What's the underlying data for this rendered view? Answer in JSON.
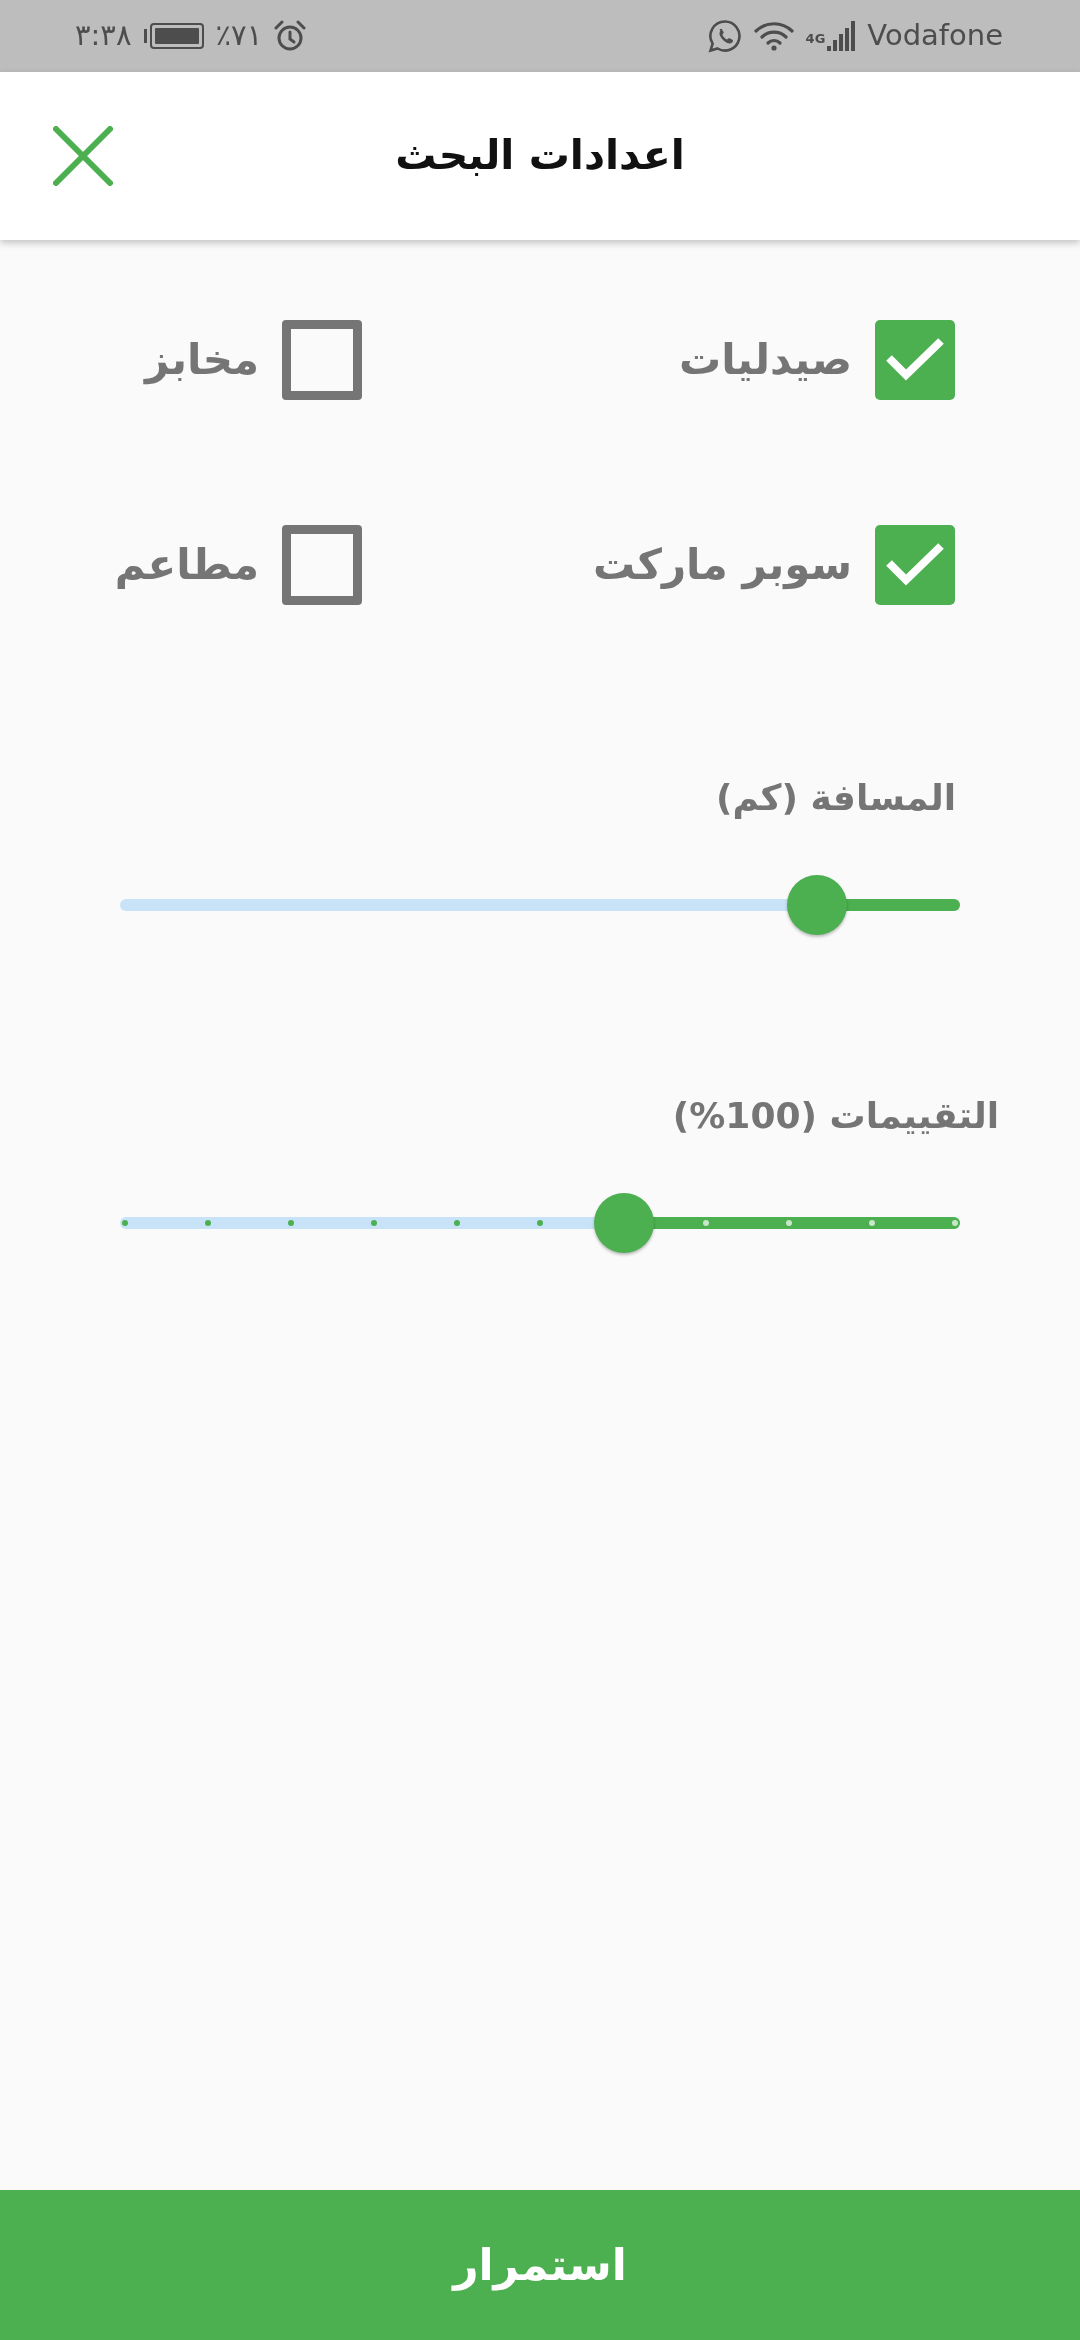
{
  "status_bar": {
    "time": "٣:٣٨",
    "battery": "٪٧١",
    "network": "4G",
    "carrier": "Vodafone"
  },
  "header": {
    "title": "اعدادات البحث"
  },
  "categories": [
    {
      "label": "صيدليات",
      "checked": true
    },
    {
      "label": "مخابز",
      "checked": false
    },
    {
      "label": "سوبر ماركت",
      "checked": true
    },
    {
      "label": "مطاعم",
      "checked": false
    }
  ],
  "sliders": [
    {
      "label": "المسافة (كم)",
      "kind": "continuous",
      "level": 0.17
    },
    {
      "label": "التقييمات (100%)",
      "kind": "stepped",
      "level": 0.4
    }
  ],
  "continue_button": {
    "label": "استمرار"
  }
}
